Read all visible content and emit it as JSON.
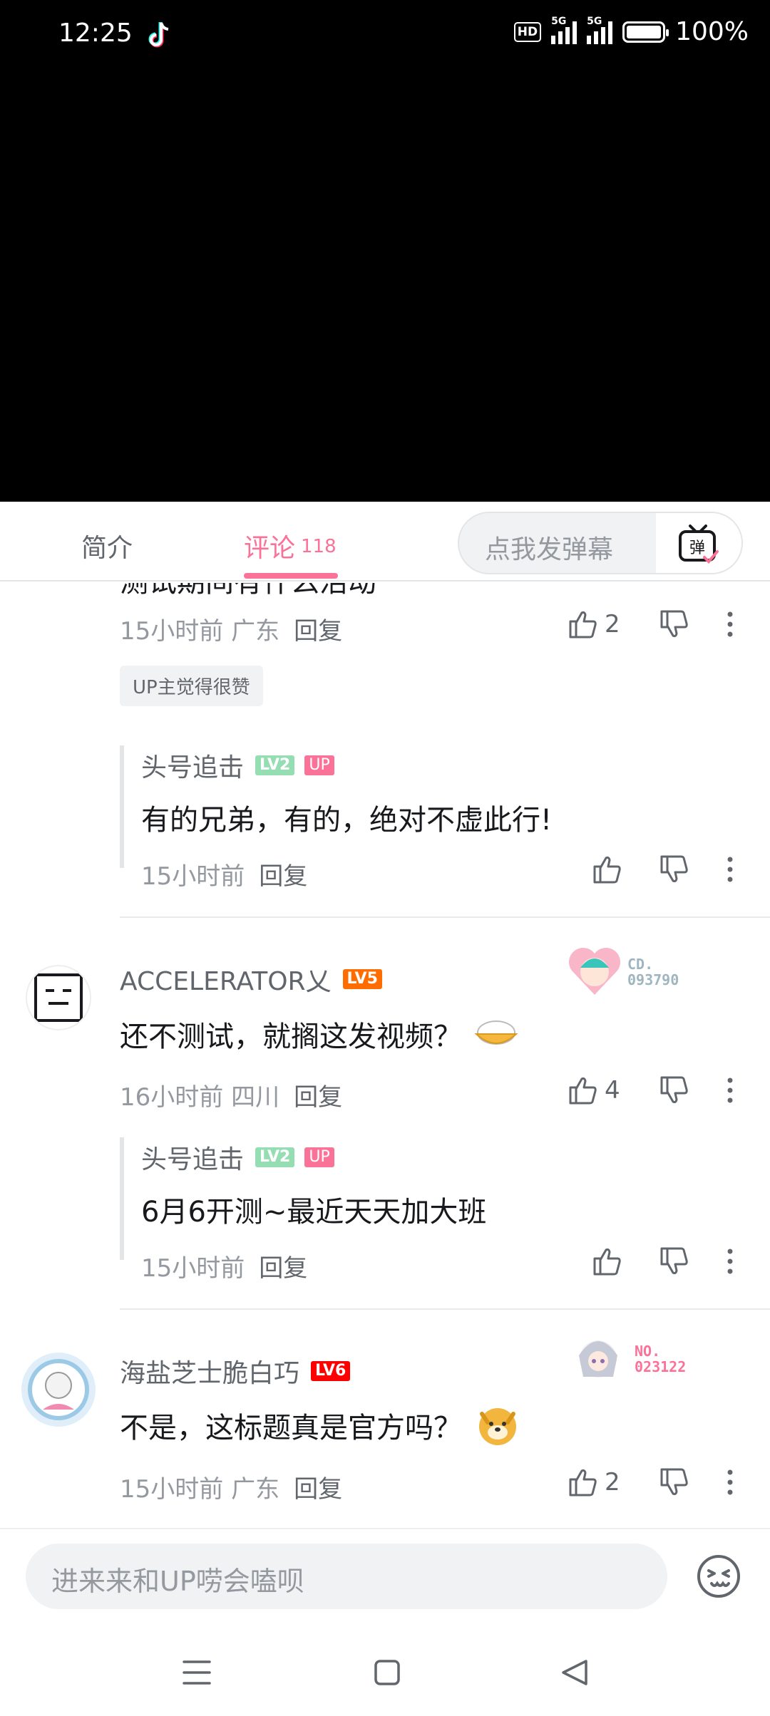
{
  "status_bar": {
    "time": "12:25",
    "hd_label": "HD",
    "network_1": "5G",
    "network_2": "5G",
    "battery": "100%"
  },
  "tabs": {
    "intro": "简介",
    "comments": "评论",
    "comment_count": "118",
    "danmu_placeholder": "点我发弹幕",
    "danmu_button_icon": "弹"
  },
  "comments": [
    {
      "time": "15小时前",
      "location": "广东",
      "reply_label": "回复",
      "likes": "2",
      "up_liked_badge": "UP主觉得很赞",
      "replies": [
        {
          "author": "头号追击",
          "level": "LV2",
          "up_badge": "UP",
          "text": "有的兄弟，有的，绝对不虚此行!",
          "time": "15小时前",
          "reply_label": "回复"
        }
      ]
    },
    {
      "author": "ACCELERATOR乂",
      "level": "LV5",
      "fan_no_label": "CD.",
      "fan_no": "093790",
      "text": "还不测试，就搁这发视频？",
      "time": "16小时前",
      "location": "四川",
      "reply_label": "回复",
      "likes": "4",
      "replies": [
        {
          "author": "头号追击",
          "level": "LV2",
          "up_badge": "UP",
          "text": "6月6开测~最近天天加大班",
          "time": "15小时前",
          "reply_label": "回复"
        }
      ]
    },
    {
      "author": "海盐芝士脆白巧",
      "level": "LV6",
      "fan_no_label": "NO.",
      "fan_no": "023122",
      "text": "不是，这标题真是官方吗？",
      "time": "15小时前",
      "location": "广东",
      "reply_label": "回复",
      "likes": "2"
    }
  ],
  "input_bar": {
    "placeholder": "进来来和UP唠会嗑呗"
  },
  "colors": {
    "accent": "#fb7299",
    "lv2": "#95ddb2",
    "lv5": "#ff6c00",
    "lv6": "#ff0000",
    "muted": "#9499a0"
  }
}
